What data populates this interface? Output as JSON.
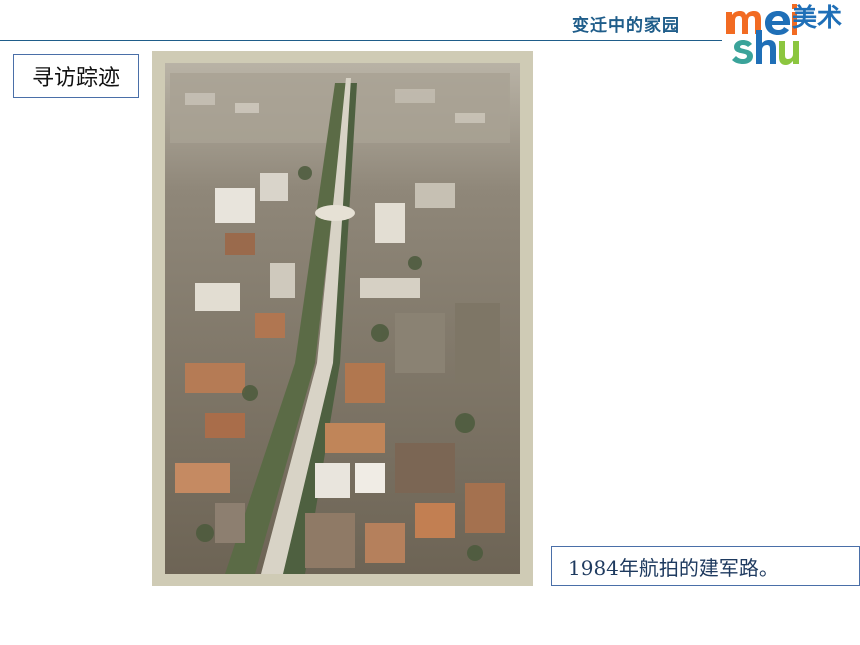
{
  "header": {
    "title": "变迁中的家园"
  },
  "logo": {
    "latin_top": "mei",
    "latin_bottom": "shu",
    "chinese": "美术",
    "colors": {
      "orange": "#f26b22",
      "blue": "#1f6fb7",
      "teal": "#3aa39a",
      "green": "#8cc63f"
    }
  },
  "section": {
    "label": "寻访踪迹"
  },
  "photo": {
    "description_icon": "aerial-photo"
  },
  "caption": {
    "text": "1984年航拍的建军路。"
  }
}
